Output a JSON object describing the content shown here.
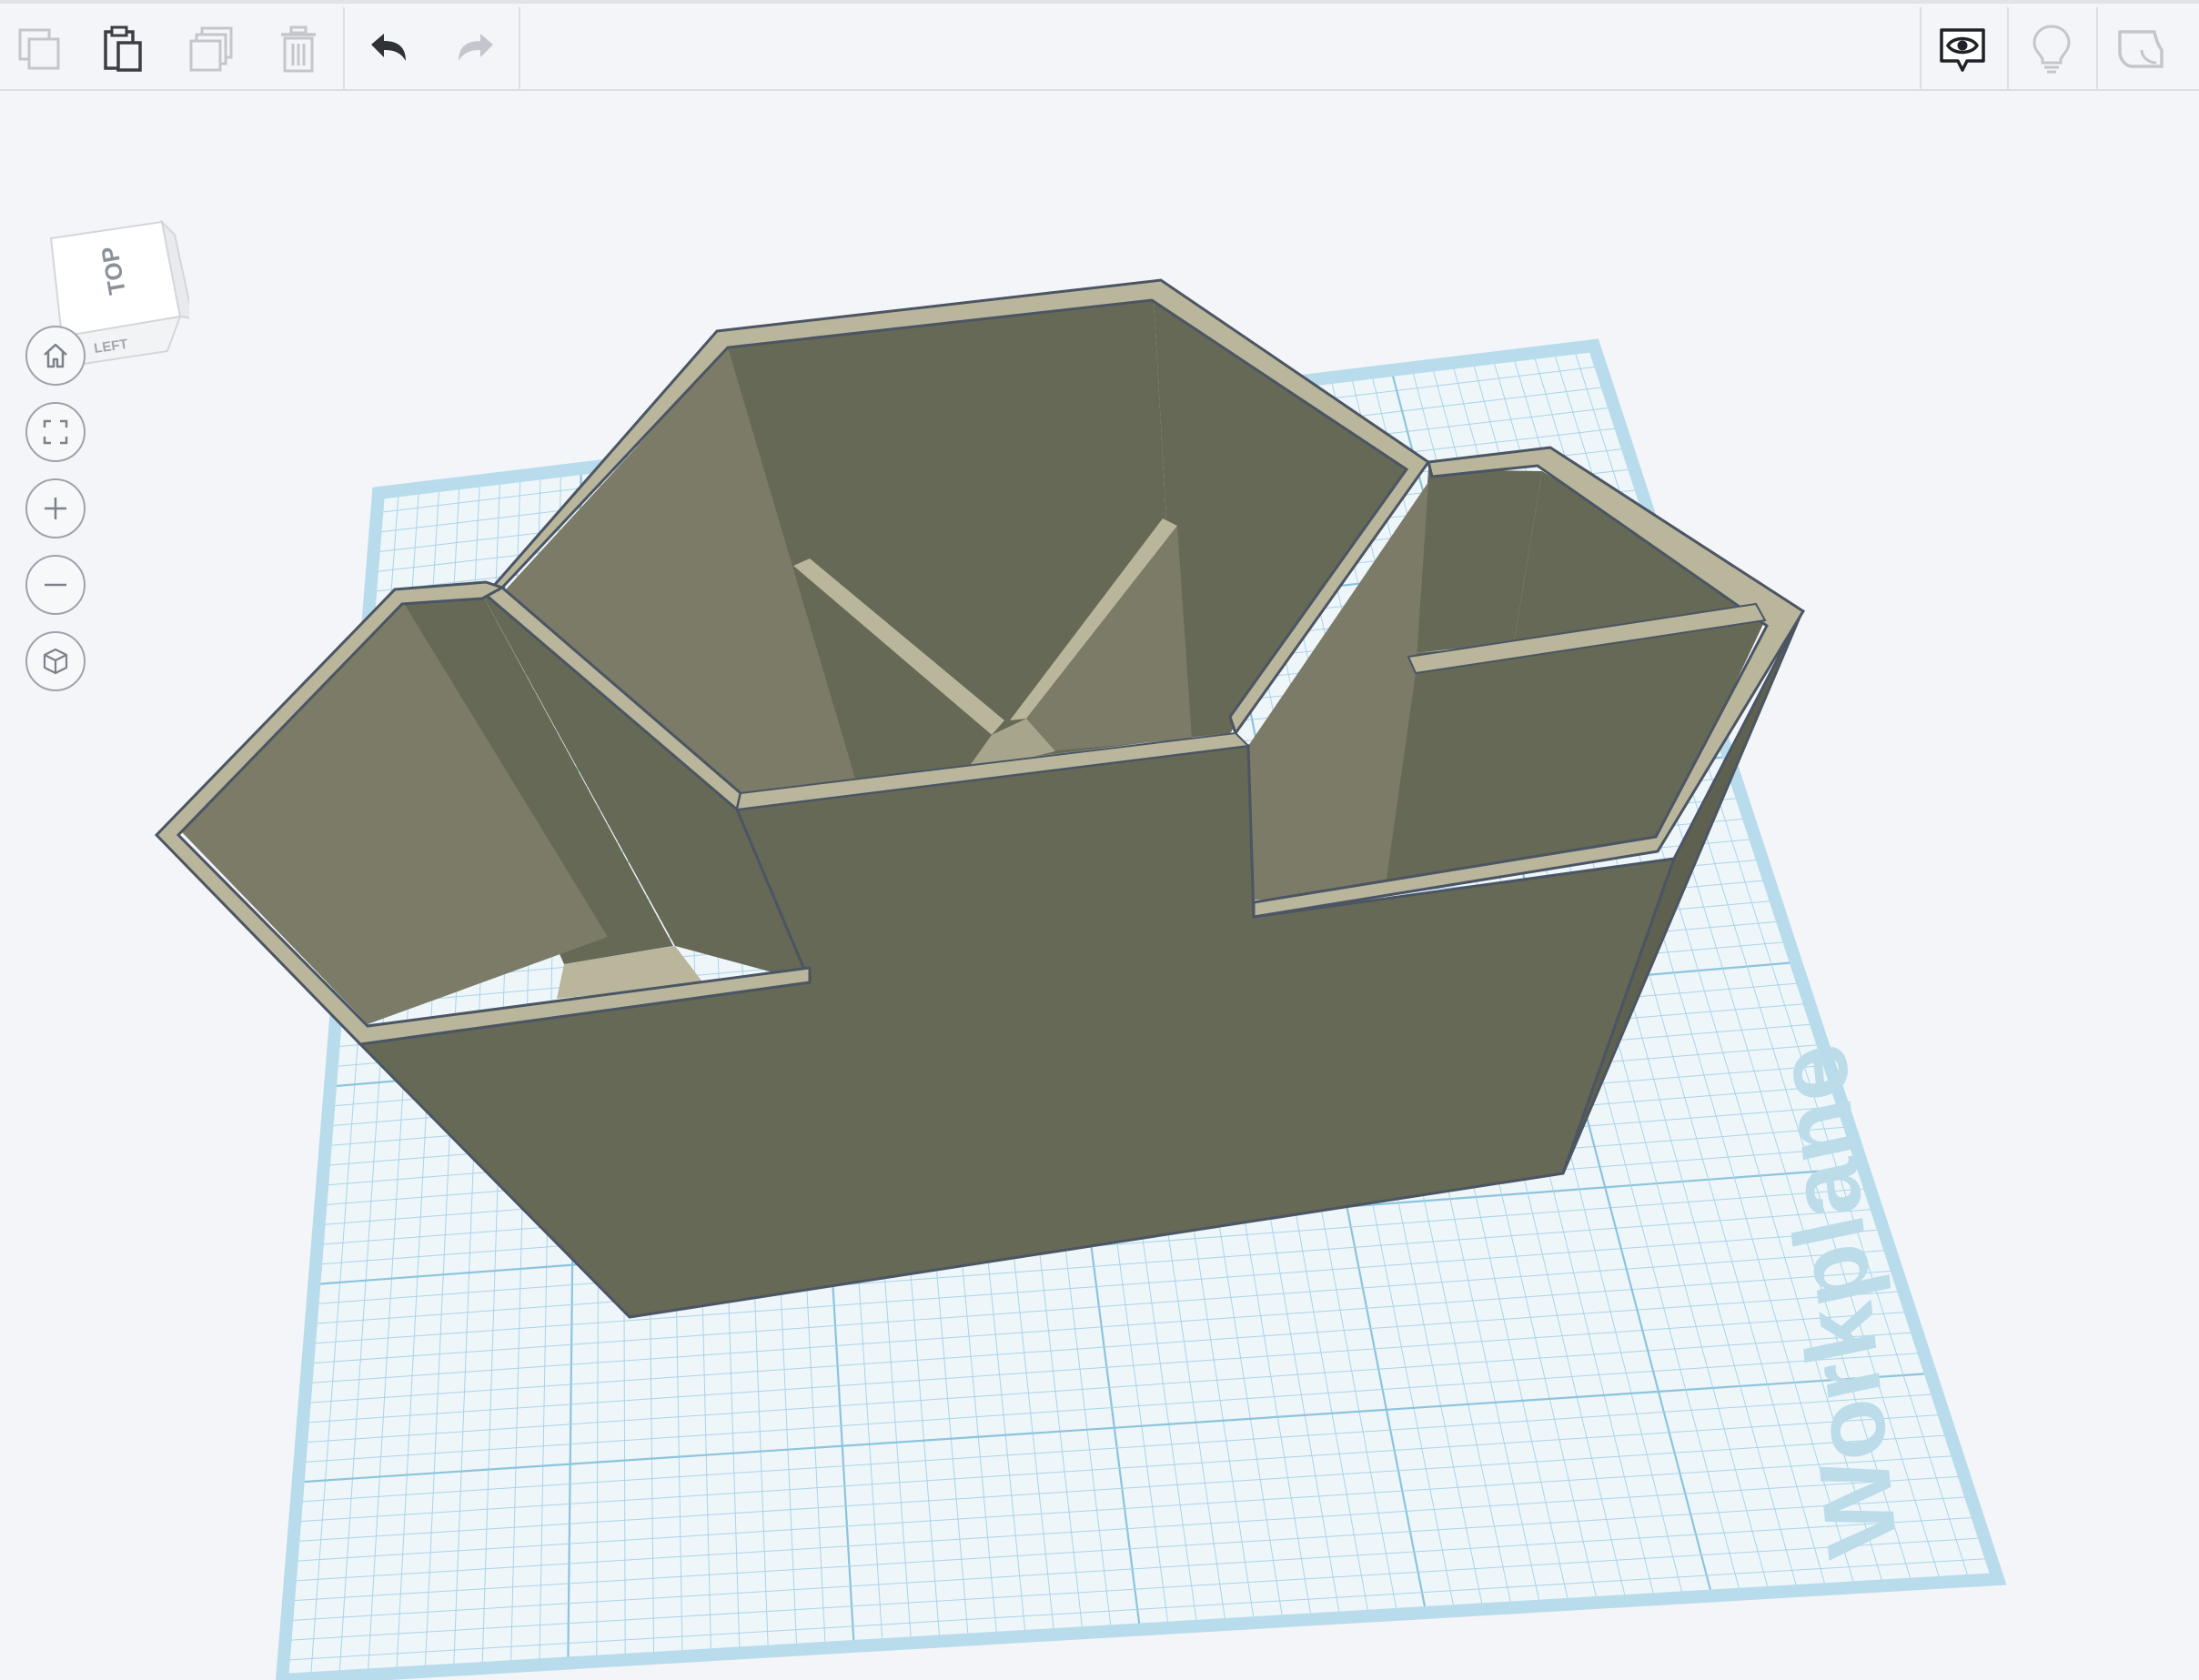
{
  "toolbar": {
    "left_buttons": [
      {
        "id": "copy",
        "icon": "copy-icon",
        "enabled": false
      },
      {
        "id": "paste",
        "icon": "paste-icon",
        "enabled": true
      },
      {
        "id": "duplicate",
        "icon": "duplicate-icon",
        "enabled": false
      },
      {
        "id": "delete",
        "icon": "trash-icon",
        "enabled": false
      },
      {
        "id": "undo",
        "icon": "undo-icon",
        "enabled": true
      },
      {
        "id": "redo",
        "icon": "redo-icon",
        "enabled": false
      }
    ],
    "right_buttons": [
      {
        "id": "notes",
        "icon": "eye-comment-icon",
        "enabled": true
      },
      {
        "id": "hint",
        "icon": "lightbulb-icon",
        "enabled": false
      },
      {
        "id": "shape-menu",
        "icon": "shape-icon",
        "enabled": false
      }
    ]
  },
  "viewcube": {
    "top_label": "TOP",
    "left_label": "LEFT"
  },
  "nav_controls": [
    {
      "id": "home",
      "icon": "home-icon"
    },
    {
      "id": "fit",
      "icon": "fit-view-icon"
    },
    {
      "id": "zoom_in",
      "icon": "plus-icon"
    },
    {
      "id": "zoom_out",
      "icon": "minus-icon"
    },
    {
      "id": "orthographic",
      "icon": "cube-view-icon"
    }
  ],
  "workplane": {
    "label": "Workplane"
  },
  "colors": {
    "grid_line": "#a9d4e8",
    "grid_major": "#8cc4dd",
    "workplane_border": "#bfe0ee",
    "object_face": "#666955",
    "object_side": "#7d7d69",
    "object_rim": "#b9b69c",
    "object_edge": "#4b5563"
  }
}
